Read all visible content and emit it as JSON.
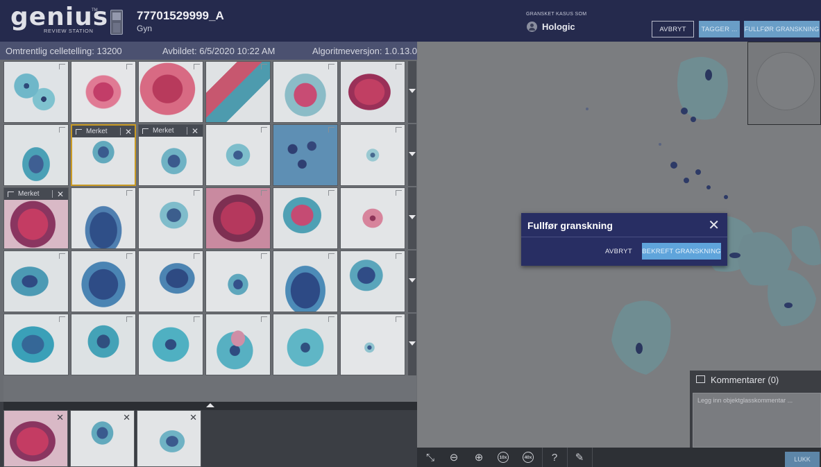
{
  "header": {
    "logo_text": "genius",
    "logo_tm": "TM",
    "logo_subtitle": "REVIEW STATION",
    "case_id": "77701529999_A",
    "case_type": "Gyn",
    "reviewed_label": "GRANSKET KASUS SOM",
    "reviewer": "Hologic",
    "cancel_label": "AVBRYT",
    "tags_label": "TAGGER ...",
    "complete_label": "FULLFØR GRANSKNING"
  },
  "info": {
    "cell_count": "Omtrentlig celletelling: 13200",
    "imaged": "Avbildet: 6/5/2020 10:22 AM",
    "algorithm": "Algoritmeversjon: 1.0.13.0"
  },
  "gallery": {
    "tag_label": "Merket",
    "close_glyph": "✕"
  },
  "dialog": {
    "title": "Fullfør granskning",
    "close_glyph": "✕",
    "cancel_label": "AVBRYT",
    "confirm_label": "BEKREFT GRANSKNING"
  },
  "comments": {
    "title": "Kommentarer (0)",
    "placeholder": "Legg inn objektglasskommentar ..."
  },
  "toolbar": {
    "fit_glyph": "⤡",
    "zoom_out_glyph": "⊖",
    "zoom_in_glyph": "⊕",
    "zoom10_label": "10x",
    "zoom40_label": "40x",
    "help_glyph": "?",
    "pen_glyph": "✎",
    "close_label": "LUKK"
  },
  "colors": {
    "header_bg": "#252a4d",
    "dialog_bg": "#282e63",
    "accent": "#5fa4db",
    "selected_border": "#c99a24"
  }
}
